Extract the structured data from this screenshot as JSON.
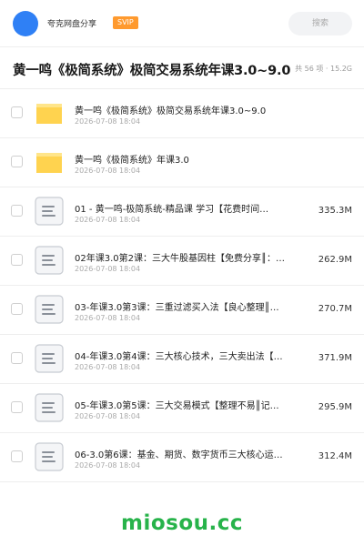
{
  "header": {
    "share_name": "夸克网盘分享",
    "badge": "SVIP",
    "search_placeholder": "搜索",
    "colors": {
      "avatar": "#2f80f5",
      "badge": "#ff9a2e"
    }
  },
  "title_bar": {
    "title": "黄一鸣《极简系统》极简交易系统年课3.0~9.0",
    "meta": "共 56 项 · 15.2G"
  },
  "files": [
    {
      "icon": "folder-icon",
      "name": "黄一鸣《极简系统》极简交易系统年课3.0~9.0",
      "date": "2026-07-08 18:04",
      "size": ""
    },
    {
      "icon": "folder-icon",
      "name": "黄一鸣《极简系统》年课3.0",
      "date": "2026-07-08 18:04",
      "size": ""
    },
    {
      "icon": "document-icon",
      "name": "01 - 黄一鸣-极简系统-精品课 学习【花费时间…",
      "date": "2026-07-08 18:04",
      "size": "335.3M"
    },
    {
      "icon": "document-icon",
      "name": "02年课3.0第2课：三大牛股基因柱【免费分享║：…",
      "date": "2026-07-08 18:04",
      "size": "262.9M"
    },
    {
      "icon": "document-icon",
      "name": "03-年课3.0第3课：三重过滤买入法【良心整理║…",
      "date": "2026-07-08 18:04",
      "size": "270.7M"
    },
    {
      "icon": "document-icon",
      "name": "04-年课3.0第4课：三大核心技术，三大卖出法【…",
      "date": "2026-07-08 18:04",
      "size": "371.9M"
    },
    {
      "icon": "document-icon",
      "name": "05-年课3.0第5课：三大交易模式【整理不易║记…",
      "date": "2026-07-08 18:04",
      "size": "295.9M"
    },
    {
      "icon": "document-icon",
      "name": "06-3.0第6课：基金、期货、数字货币三大核心运…",
      "date": "2026-07-08 18:04",
      "size": "312.4M"
    }
  ],
  "watermark": "miosou.cc"
}
